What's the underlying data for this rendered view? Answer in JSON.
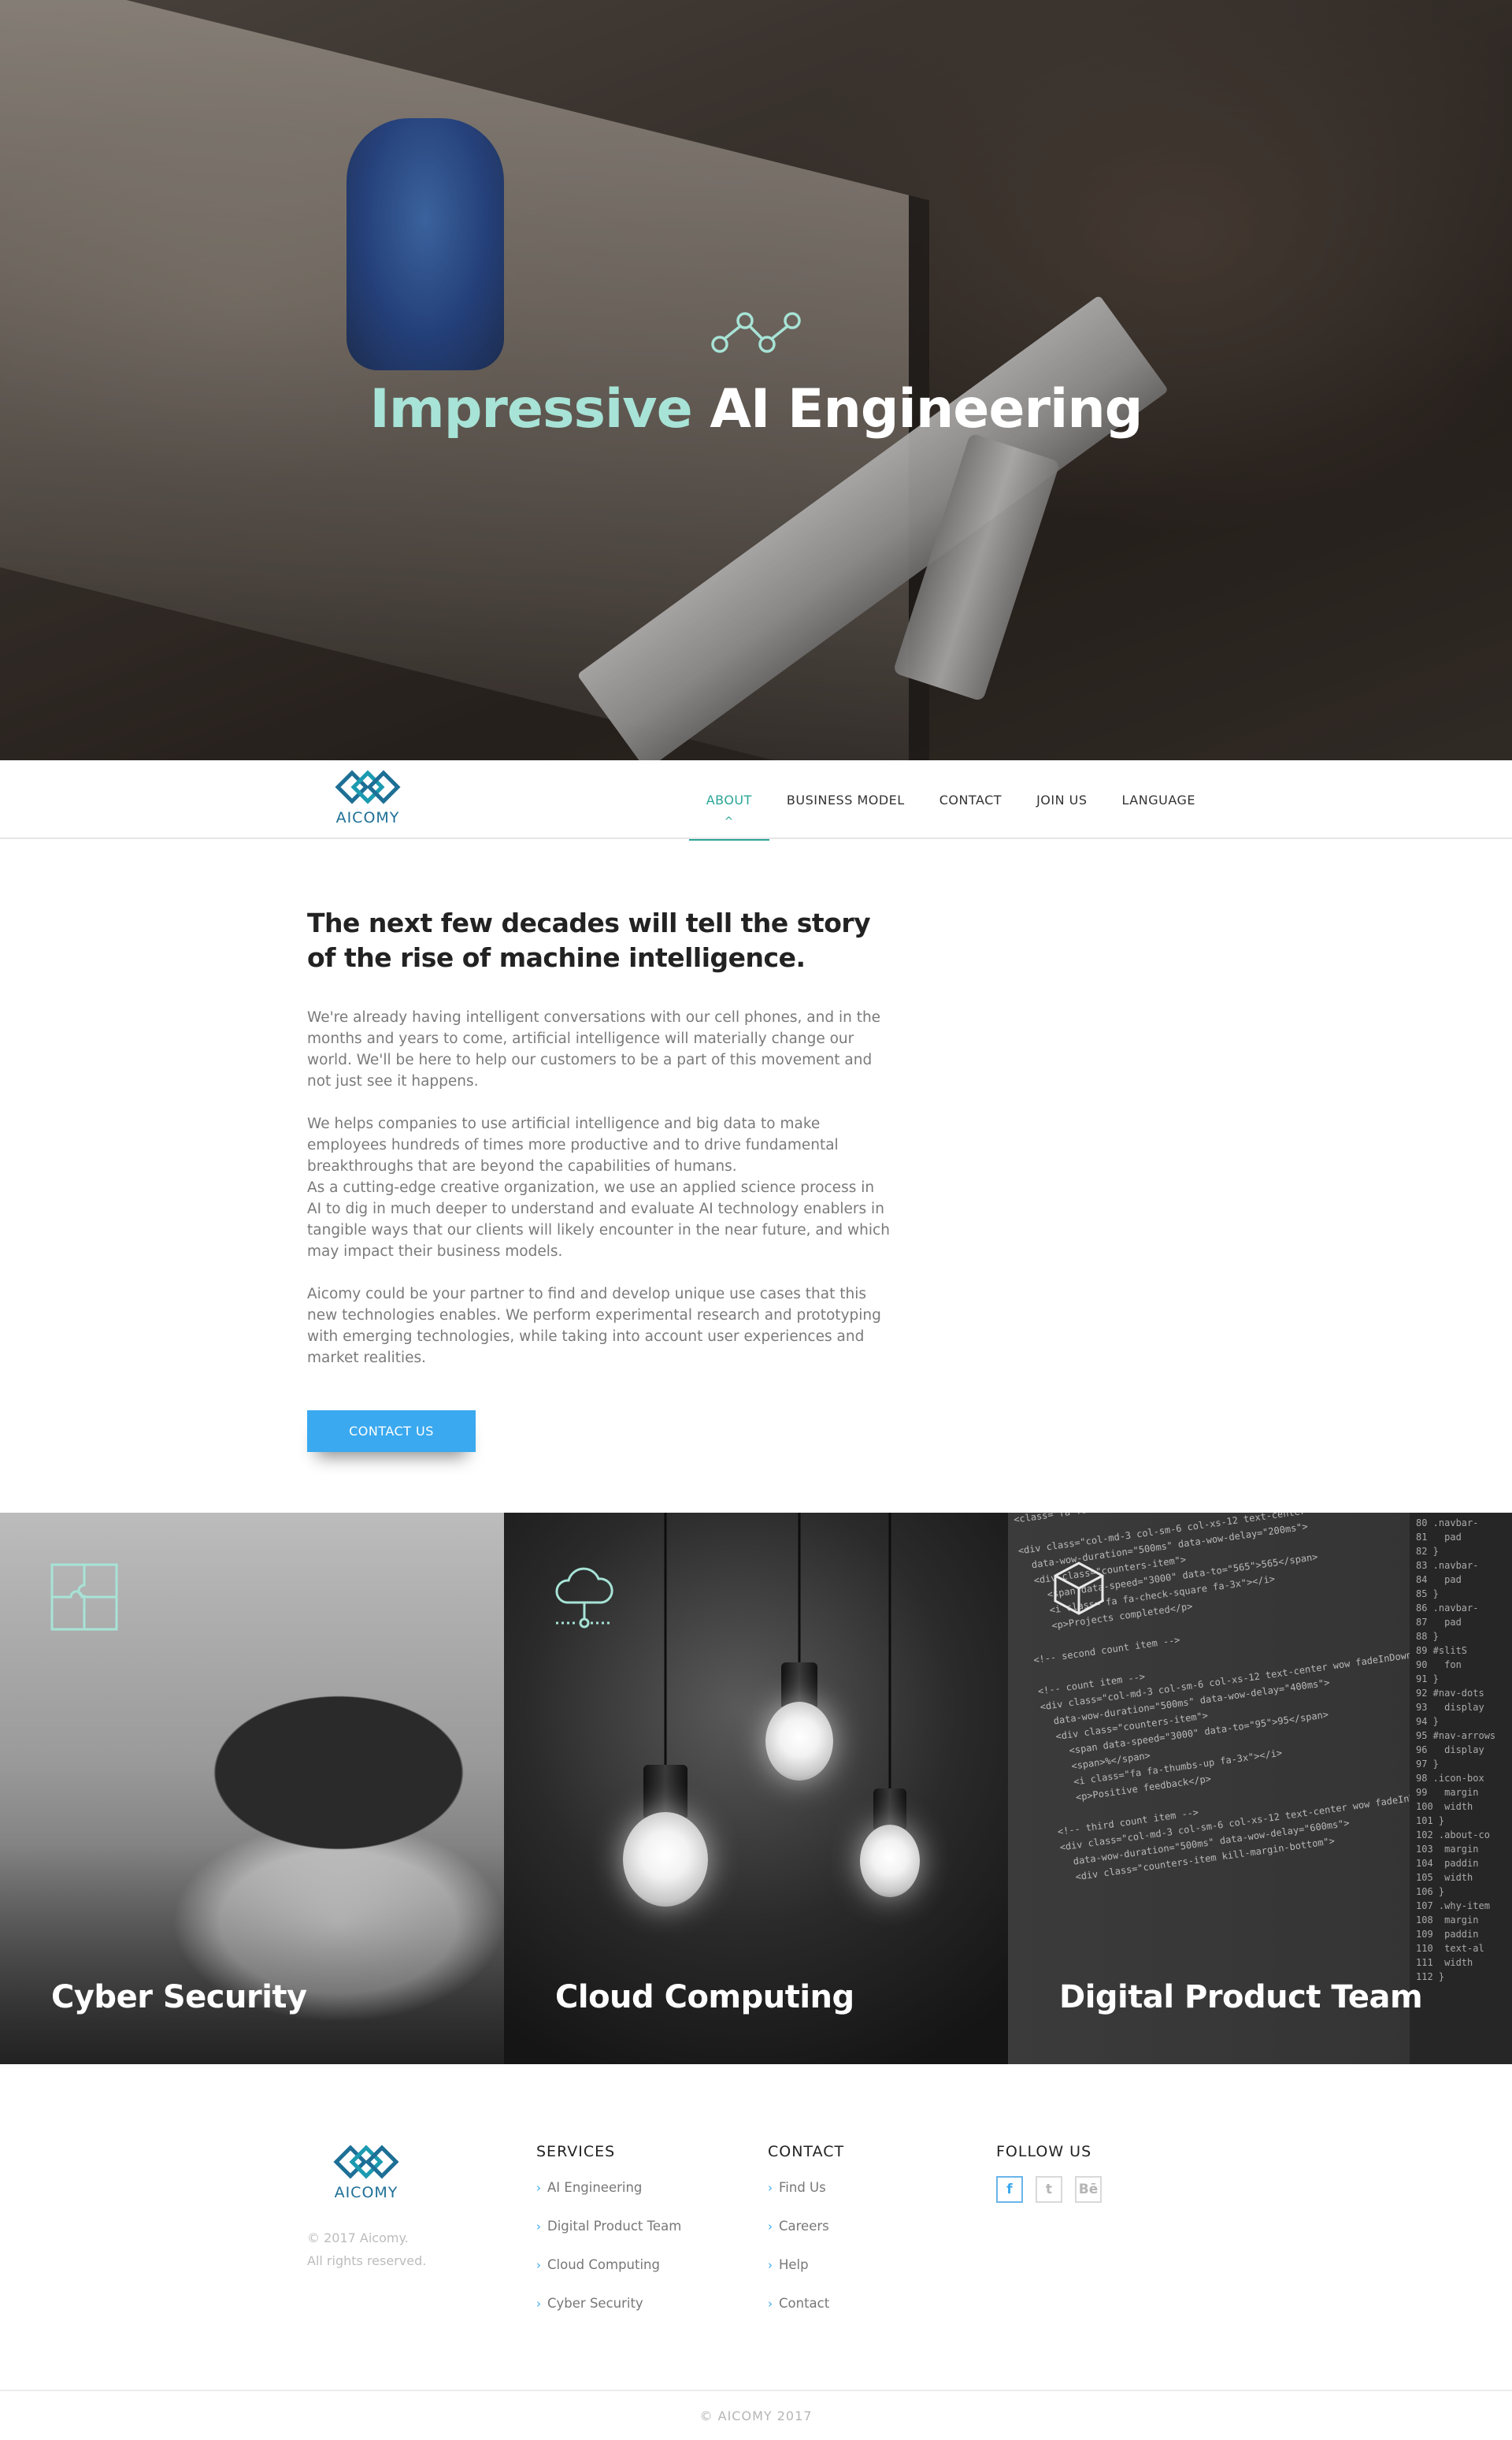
{
  "hero": {
    "title_accent": "Impressive",
    "title_main": "AI Engineering",
    "icon": "network-nodes-icon",
    "accent_color": "#a7e3d6"
  },
  "nav": {
    "brand": "AICOMY",
    "items": [
      {
        "label": "ABOUT",
        "active": true
      },
      {
        "label": "BUSINESS MODEL",
        "active": false
      },
      {
        "label": "CONTACT",
        "active": false
      },
      {
        "label": "JOIN US",
        "active": false
      },
      {
        "label": "LANGUAGE",
        "active": false
      }
    ],
    "active_color": "#2ba597"
  },
  "about": {
    "heading": "The next few decades will tell the story of the rise of machine intelligence.",
    "paragraphs": [
      "We're already having intelligent conversations with our cell phones, and in the months and years to come, artificial intelligence will materially change our world. We'll be here to help our customers to be a part of this movement and not just see it happens.",
      "We helps companies to use artificial intelligence and big data to make employees hundreds of times more productive and to drive fundamental breakthroughs that are beyond the capabilities of humans.",
      "As a cutting-edge creative organization, we use an applied science process in AI to dig in much deeper to understand and evaluate AI technology enablers in tangible ways that our clients will likely encounter in the near future, and which may impact their business models.",
      "Aicomy could be your partner to find and develop unique use cases that this new technologies enables. We perform experimental research and prototyping with emerging technologies, while taking into account user experiences and market realities."
    ],
    "button_label": "CONTACT US",
    "button_color": "#3aa9ef"
  },
  "services": [
    {
      "title": "Cyber Security",
      "icon": "puzzle-icon"
    },
    {
      "title": "Cloud Computing",
      "icon": "cloud-icon"
    },
    {
      "title": "Digital Product Team",
      "icon": "cube-icon"
    }
  ],
  "footer": {
    "brand": "AICOMY",
    "copyright_lines": [
      "© 2017 Aicomy.",
      "All rights reserved."
    ],
    "columns": [
      {
        "heading": "SERVICES",
        "links": [
          "AI Engineering",
          "Digital Product Team",
          "Cloud Computing",
          "Cyber Security"
        ]
      },
      {
        "heading": "CONTACT",
        "links": [
          "Find Us",
          "Careers",
          "Help",
          "Contact"
        ]
      }
    ],
    "follow_heading": "FOLLOW US",
    "social": [
      {
        "icon": "facebook-icon",
        "glyph": "f"
      },
      {
        "icon": "twitter-icon",
        "glyph": "t"
      },
      {
        "icon": "behance-icon",
        "glyph": "Bē"
      }
    ],
    "bottom": "© AICOMY 2017"
  }
}
